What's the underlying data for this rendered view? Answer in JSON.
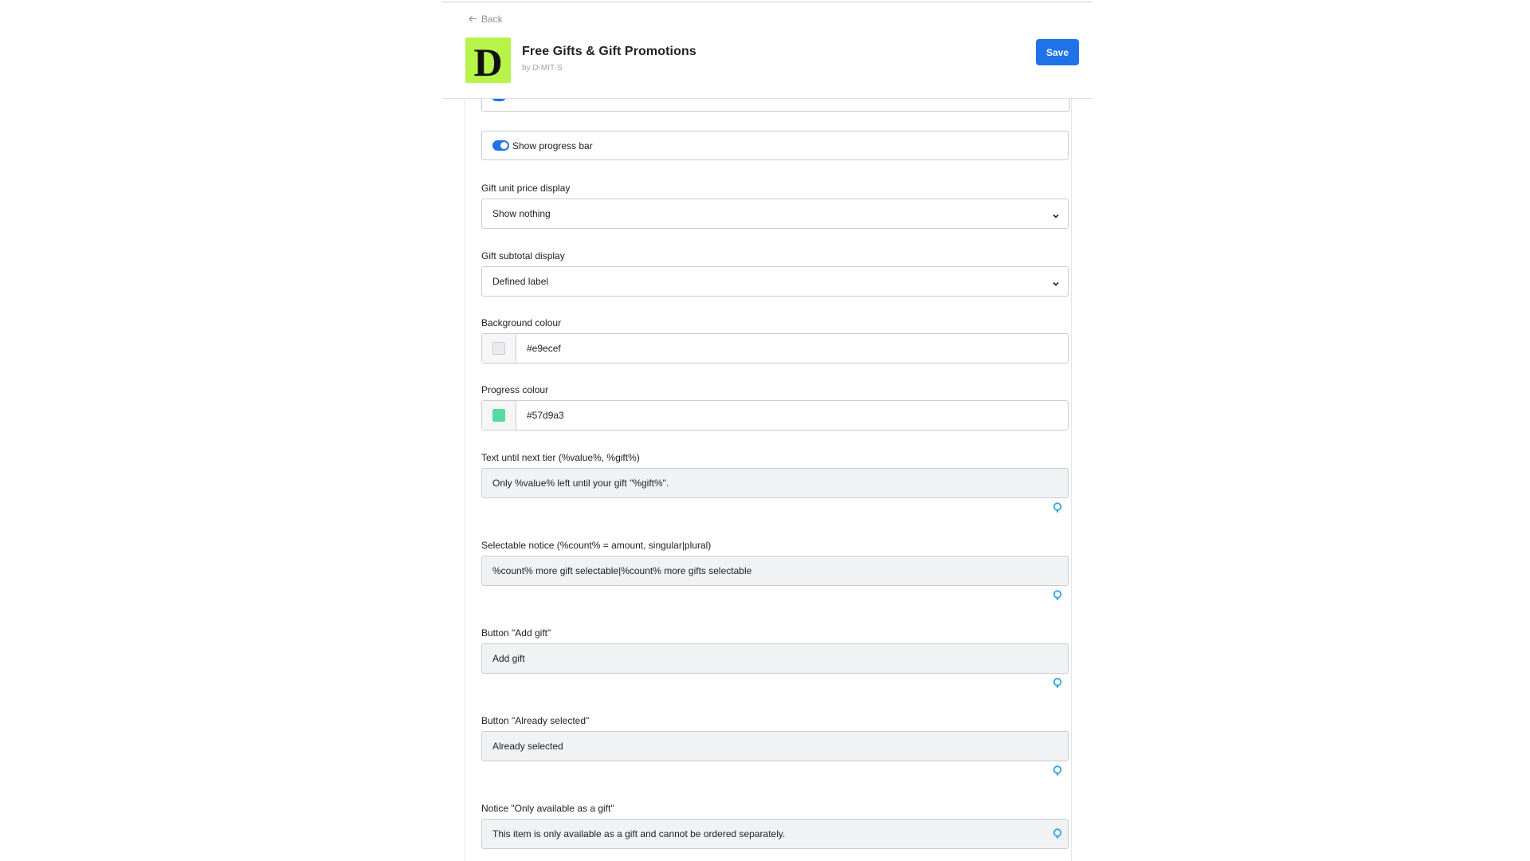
{
  "header": {
    "back_label": "Back",
    "app_title": "Free Gifts & Gift Promotions",
    "app_by": "by D-MIT-S",
    "logo_letter": "D",
    "save_label": "Save"
  },
  "colors": {
    "accent": "#1f73e7",
    "logo_background": "#b7f44a"
  },
  "settings": {
    "progress_toggle": {
      "label": "Show progress bar",
      "enabled": true
    },
    "unit_price": {
      "label": "Gift unit price display",
      "value": "Show nothing"
    },
    "subtotal": {
      "label": "Gift subtotal display",
      "value": "Defined label"
    },
    "background_colour": {
      "label": "Background colour",
      "value": "#e9ecef"
    },
    "progress_colour": {
      "label": "Progress colour",
      "value": "#57d9a3"
    },
    "text_next_tier": {
      "label": "Text until next tier (%value%, %gift%)",
      "value": "Only %value% left until your gift \"%gift%\"."
    },
    "selectable_notice": {
      "label": "Selectable notice (%count% = amount, singular|plural)",
      "value": "%count% more gift selectable|%count% more gifts selectable"
    },
    "button_add_gift": {
      "label": "Button \"Add gift\"",
      "value": "Add gift"
    },
    "button_already_selected": {
      "label": "Button \"Already selected\"",
      "value": "Already selected"
    },
    "notice_only_gift": {
      "label": "Notice \"Only available as a gift\"",
      "value": "This item is only available as a gift and cannot be ordered separately."
    }
  },
  "icons": {
    "back": "arrow-left-icon",
    "select": "chevron-down-icon",
    "translate": "translate-pin-icon"
  }
}
